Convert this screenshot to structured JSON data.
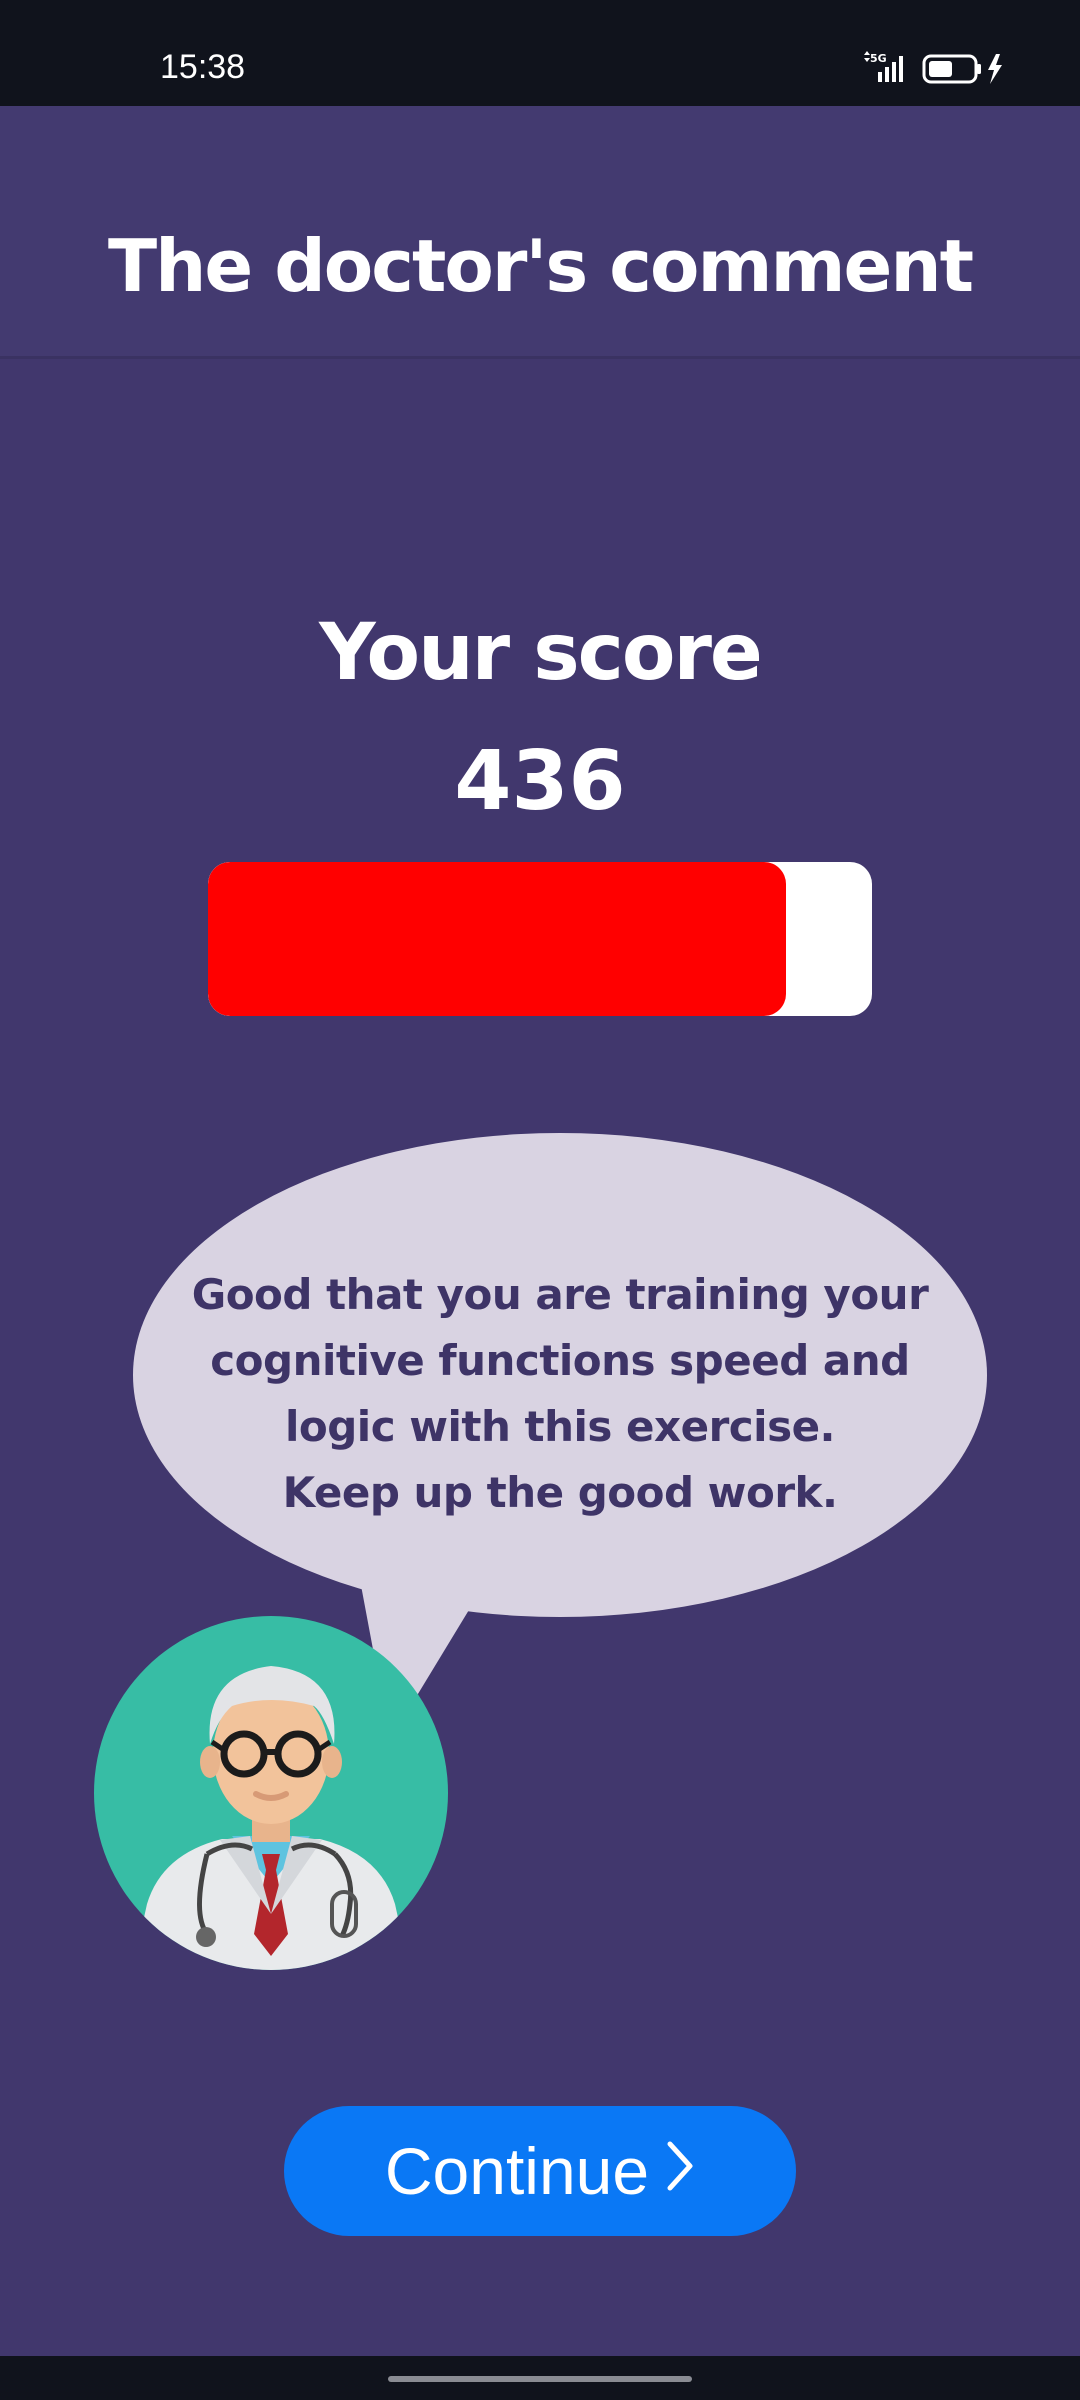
{
  "status_bar": {
    "time": "15:38",
    "network_label": "5G",
    "battery_level": 0.55
  },
  "header": {
    "title": "The doctor's comment"
  },
  "score": {
    "label": "Your score",
    "value": "436",
    "progress_fraction": 0.87
  },
  "comment": {
    "lines": [
      "Good that you are training your",
      "cognitive functions speed and",
      "logic with this exercise.",
      "Keep up the good work."
    ]
  },
  "continue_button": {
    "label": "Continue"
  },
  "icons": {
    "signal": "signal-icon",
    "battery": "battery-icon",
    "charging": "lightning-icon",
    "chevron": "chevron-right-icon",
    "doctor": "doctor-avatar"
  },
  "colors": {
    "background": "#41376d",
    "progress_fill": "#ff0000",
    "button": "#0a78f5",
    "bubble": "#d9d3e2",
    "avatar_bg": "#37bda5"
  }
}
